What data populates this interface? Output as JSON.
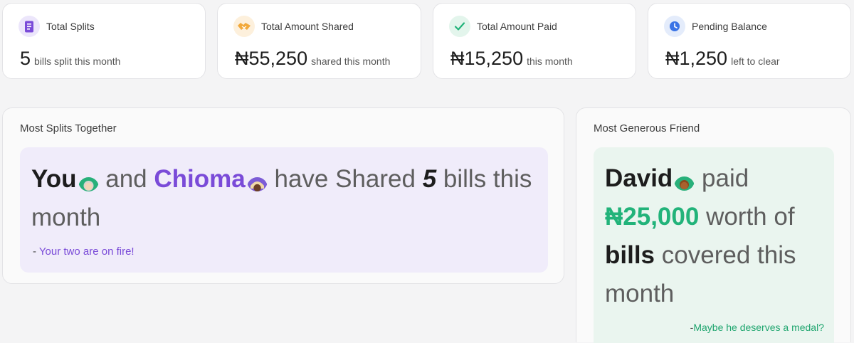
{
  "stats": [
    {
      "label": "Total Splits",
      "value": "5",
      "sub": "bills split this month"
    },
    {
      "label": "Total Amount Shared",
      "value": "₦55,250",
      "sub": "shared this month"
    },
    {
      "label": "Total Amount Paid",
      "value": "₦15,250",
      "sub": "this month"
    },
    {
      "label": "Pending Balance",
      "value": "₦1,250",
      "sub": "left to clear"
    }
  ],
  "icons": {
    "splits": "receipt-icon",
    "shared": "handshake-icon",
    "paid": "checkmark-icon",
    "pending": "clock-icon"
  },
  "colors": {
    "purple_accent": "#7a4bd8",
    "green_accent": "#22b37a",
    "splits_icon_bg": "#ece6fb",
    "shared_icon_bg": "#fdf0dc",
    "paid_icon_bg": "#e3f5ec",
    "pending_icon_bg": "#e4ecfb"
  },
  "most_splits": {
    "title": "Most Splits Together",
    "you": "You",
    "and": "and",
    "friend": "Chioma",
    "have_shared": "have Shared",
    "count": "5",
    "bills_this": "bills this month",
    "quote_dash": "-",
    "quote": "Your two are on fire!"
  },
  "most_generous": {
    "title": "Most Generous Friend",
    "friend": "David",
    "paid": "paid",
    "amount": "₦25,000",
    "worth_of": "worth of",
    "bills": "bills",
    "covered": "covered this month",
    "medal_dash": "-",
    "medal": "Maybe he deserves a medal?"
  }
}
